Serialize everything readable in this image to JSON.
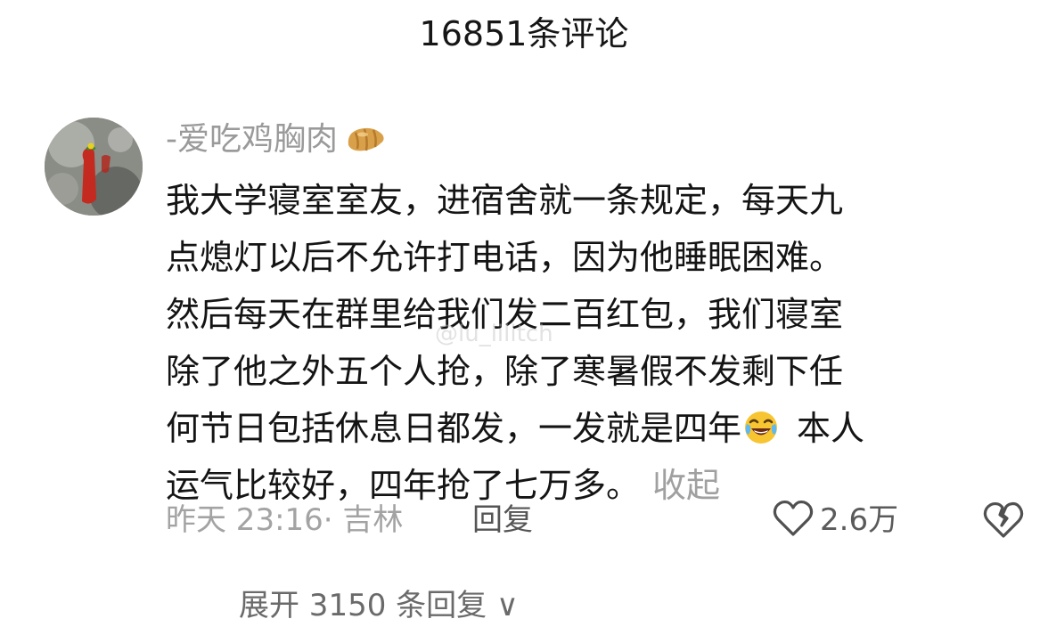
{
  "header": {
    "title": "16851条评论"
  },
  "comment": {
    "username": "-爱吃鸡胸肉",
    "username_badge_icon": "croissant-emoji-icon",
    "body_lines": [
      "我大学寝室室友，进宿舍就一条规定，每天九",
      "点熄灯以后不允许打电话，因为他睡眠困难。",
      "然后每天在群里给我们发二百红包，我们寝室",
      "除了他之外五个人抢，除了寒暑假不发剩下任",
      "何节日包括休息日都发，一发就是四年",
      "本人",
      "运气比较好，四年抢了七万多。"
    ],
    "inline_emoji_icon": "laughing-tears-emoji-icon",
    "collapse_label": "收起",
    "time_location": "昨天 23:16· 吉林",
    "reply_label": "回复",
    "like_icon": "heart-outline-icon",
    "like_count": "2.6万",
    "dislike_icon": "broken-heart-icon",
    "watermark": "@lu_lilitch"
  },
  "footer": {
    "expand_replies_label": "展开 3150 条回复 ∨"
  },
  "colors": {
    "text_primary": "#141414",
    "text_secondary": "#9a9a9a",
    "background": "#ffffff"
  }
}
